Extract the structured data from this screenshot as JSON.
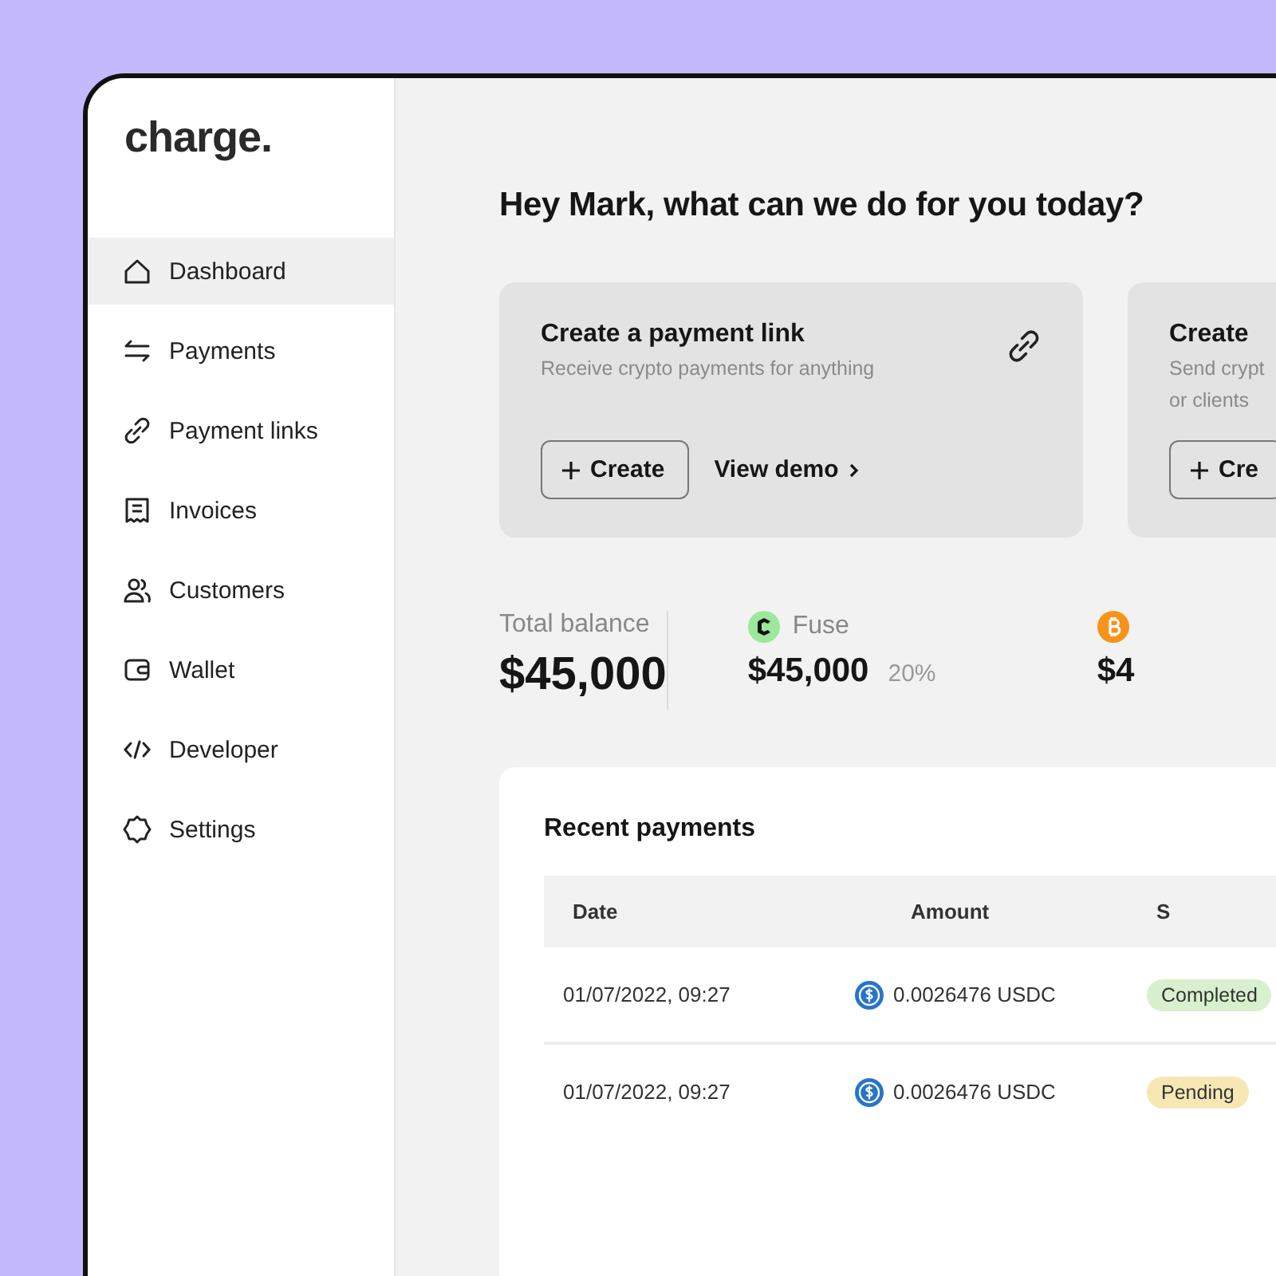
{
  "brand": "charge.",
  "sidebar": {
    "items": [
      {
        "label": "Dashboard",
        "selected": true
      },
      {
        "label": "Payments",
        "selected": false
      },
      {
        "label": "Payment links",
        "selected": false
      },
      {
        "label": "Invoices",
        "selected": false
      },
      {
        "label": "Customers",
        "selected": false
      },
      {
        "label": "Wallet",
        "selected": false
      },
      {
        "label": "Developer",
        "selected": false
      },
      {
        "label": "Settings",
        "selected": false
      }
    ]
  },
  "greeting": "Hey Mark, what can we do for you today?",
  "action_cards": [
    {
      "title": "Create a payment link",
      "subtitle_lines": [
        "Receive crypto payments for anything"
      ],
      "create_button": "Create",
      "demo_link": "View demo"
    },
    {
      "title": "Create",
      "subtitle_lines": [
        "Send crypt",
        "or clients"
      ],
      "create_button": "Cre"
    }
  ],
  "total_balance": {
    "label": "Total balance",
    "amount": "$45,000"
  },
  "assets": [
    {
      "name": "Fuse",
      "amount": "$45,000",
      "share": "20%"
    },
    {
      "amount": "$4"
    }
  ],
  "recent_payments": {
    "title": "Recent payments",
    "columns": [
      "Date",
      "Amount",
      "S"
    ],
    "rows": [
      {
        "date": "01/07/2022, 09:27",
        "amount": "0.0026476 USDC",
        "status": "Completed",
        "color": "#d8f0cd"
      },
      {
        "date": "01/07/2022, 09:27",
        "amount": "0.0026476 USDC",
        "status": "Pending",
        "color": "#f7e7b5"
      }
    ]
  }
}
